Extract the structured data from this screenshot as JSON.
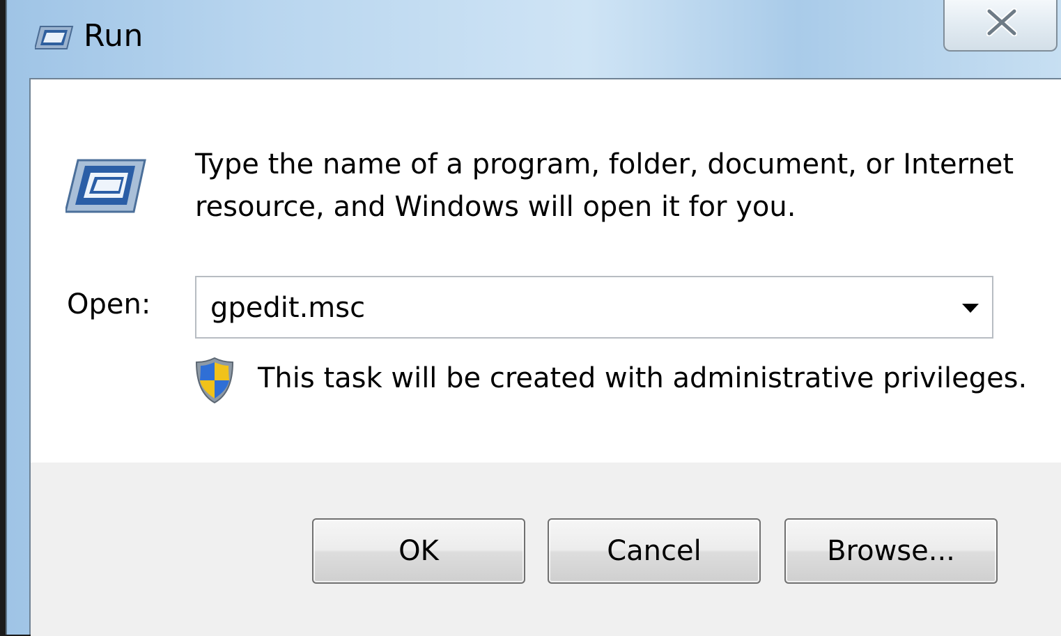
{
  "window": {
    "title": "Run",
    "close_symbol": "X"
  },
  "dialog": {
    "description": "Type the name of a program, folder, document, or Internet resource, and Windows will open it for you.",
    "open_label": "Open:",
    "open_value": "gpedit.msc",
    "admin_notice": "This task will be created with administrative privileges."
  },
  "buttons": {
    "ok": "OK",
    "cancel": "Cancel",
    "browse": "Browse..."
  },
  "icons": {
    "title": "run-icon",
    "main": "run-program-icon",
    "admin": "uac-shield-icon",
    "dropdown": "dropdown-arrow-icon",
    "close": "close-icon"
  },
  "colors": {
    "titlebar": "#b9d6ef",
    "client": "#ffffff",
    "footer": "#f0f0f0",
    "border": "#6f8294"
  }
}
